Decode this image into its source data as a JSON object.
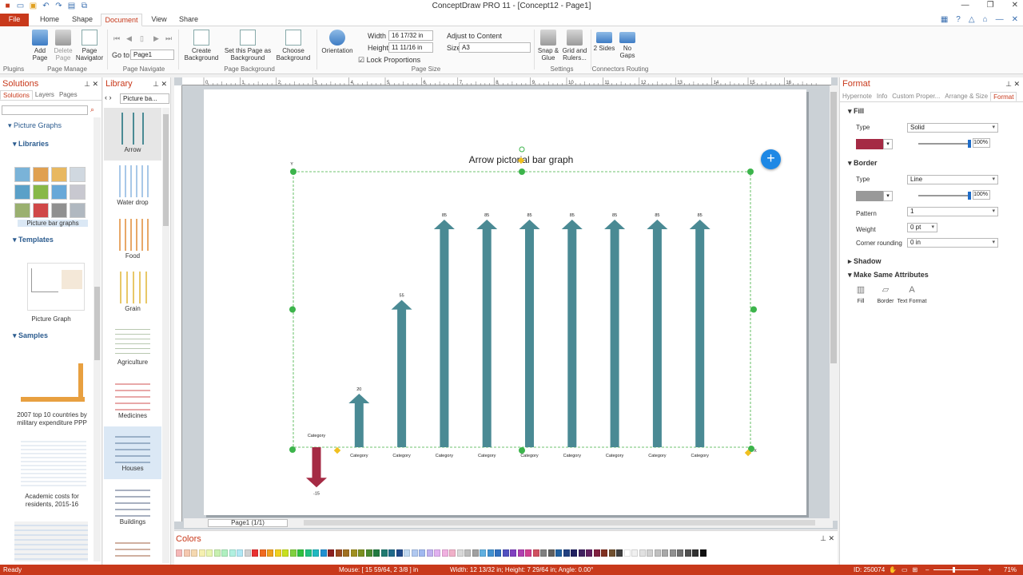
{
  "app": {
    "title": "ConceptDraw PRO 11 - [Concept12 - Page1]"
  },
  "ribbon_tabs": [
    "File",
    "Home",
    "Shape",
    "Document",
    "View",
    "Share"
  ],
  "ribbon": {
    "add_page": "Add Page",
    "delete_page": "Delete Page",
    "page_navigator": "Page Navigator",
    "goto_label": "Go to:",
    "goto_value": "Page1",
    "create_background": "Create Background",
    "set_page_background": "Set this Page as Background",
    "choose_background": "Choose Background",
    "orientation": "Orientation",
    "width_label": "Width",
    "width_value": "16 17/32 in",
    "height_label": "Height",
    "height_value": "11 11/16 in",
    "adjust_content": "Adjust to Content",
    "size_label": "Size",
    "size_value": "A3",
    "lock_proportions": "Lock Proportions",
    "snap_glue": "Snap & Glue",
    "grid_rulers": "Grid and Rulers...",
    "two_sides": "2 Sides",
    "no_gaps": "No Gaps",
    "groups": {
      "plugins": "Plugins",
      "page_manage": "Page Manage",
      "page_navigate": "Page Navigate",
      "page_background": "Page Background",
      "page_size": "Page Size",
      "settings": "Settings",
      "connectors_routing": "Connectors Routing"
    }
  },
  "solutions": {
    "title": "Solutions",
    "tabs": [
      "Solutions",
      "Layers",
      "Pages"
    ],
    "tree_root": "Picture Graphs",
    "libraries_label": "Libraries",
    "library_caption": "Picture bar graphs",
    "templates_label": "Templates",
    "template_caption": "Picture Graph",
    "samples_label": "Samples",
    "sample1": "2007 top 10 countries by military expenditure PPP",
    "sample2": "Academic costs for residents, 2015-16"
  },
  "library": {
    "title": "Library",
    "dropdown": "Picture ba...",
    "items": [
      "Arrow",
      "Water drop",
      "Food",
      "Grain",
      "Agriculture",
      "Medicines",
      "Houses",
      "Buildings"
    ]
  },
  "canvas": {
    "page_indicator": "Page1 (1/1)",
    "ruler_marks": [
      "0",
      "1",
      "2",
      "3",
      "4",
      "5",
      "6",
      "7",
      "8",
      "9",
      "10",
      "11",
      "12",
      "13",
      "14",
      "15",
      "16"
    ]
  },
  "chart_data": {
    "type": "bar",
    "title": "Arrow pictorial bar graph",
    "categories": [
      "Category",
      "Category",
      "Category",
      "Category",
      "Category",
      "Category",
      "Category",
      "Category",
      "Category",
      "Category"
    ],
    "values": [
      -15,
      20,
      55,
      85,
      85,
      85,
      85,
      85,
      85,
      85
    ],
    "colors": {
      "positive": "#4a8a94",
      "negative": "#a52a44"
    },
    "ylim": [
      -15,
      85
    ],
    "ylabel": "Y",
    "xlabel": "X"
  },
  "colors_panel": {
    "title": "Colors",
    "swatches": [
      "#f5b8b8",
      "#f5c8b0",
      "#f5d8b0",
      "#f5f0b0",
      "#e8f5b0",
      "#c8f0b0",
      "#b0f0c0",
      "#b0f0e0",
      "#b0e8f5",
      "#d0d0d0",
      "#e83030",
      "#f06a20",
      "#f0a020",
      "#f0d020",
      "#c8e020",
      "#80d040",
      "#30c040",
      "#20c080",
      "#20b8c0",
      "#2090d0",
      "#8b2020",
      "#9a4a20",
      "#a07020",
      "#a09020",
      "#7a9020",
      "#4a8a30",
      "#207a40",
      "#207a70",
      "#206a8a",
      "#204a8a",
      "#c0d8f0",
      "#b0c8f0",
      "#a0b8f0",
      "#c0b0f0",
      "#e0b0f0",
      "#f0b0e0",
      "#f0b0c8",
      "#d8d8d8",
      "#bcbcbc",
      "#a0a0a0",
      "#60b0e0",
      "#4090d0",
      "#3070c0",
      "#5050c0",
      "#8040c0",
      "#b040b0",
      "#d04090",
      "#d05060",
      "#808080",
      "#606060",
      "#2060a0",
      "#204080",
      "#202060",
      "#402060",
      "#602060",
      "#802040",
      "#803020",
      "#705030",
      "#404040",
      "#ffffff",
      "#f0f0f0",
      "#e0e0e0",
      "#d0d0d0",
      "#c0c0c0",
      "#a8a8a8",
      "#909090",
      "#707070",
      "#505050",
      "#303030",
      "#101010"
    ]
  },
  "format": {
    "title": "Format",
    "tabs": [
      "Hypernote",
      "Info",
      "Custom Proper...",
      "Arrange & Size",
      "Format"
    ],
    "fill": "Fill",
    "type_label": "Type",
    "fill_type": "Solid",
    "fill_color": "#a52a44",
    "fill_opacity": "100%",
    "border": "Border",
    "border_type": "Line",
    "border_color": "#999999",
    "border_opacity": "100%",
    "pattern_label": "Pattern",
    "pattern_value": "1",
    "weight_label": "Weight",
    "weight_value": "0 pt",
    "corner_label": "Corner rounding",
    "corner_value": "0 in",
    "shadow": "Shadow",
    "make_same": "Make Same Attributes",
    "ms_fill": "Fill",
    "ms_border": "Border",
    "ms_text": "Text Format"
  },
  "status": {
    "ready": "Ready",
    "mouse": "Mouse: [ 15 59/64, 2 3/8 ] in",
    "size": "Width: 12 13/32 in;  Height: 7 29/64 in;  Angle: 0.00°",
    "id": "ID: 250074",
    "zoom": "71%"
  }
}
